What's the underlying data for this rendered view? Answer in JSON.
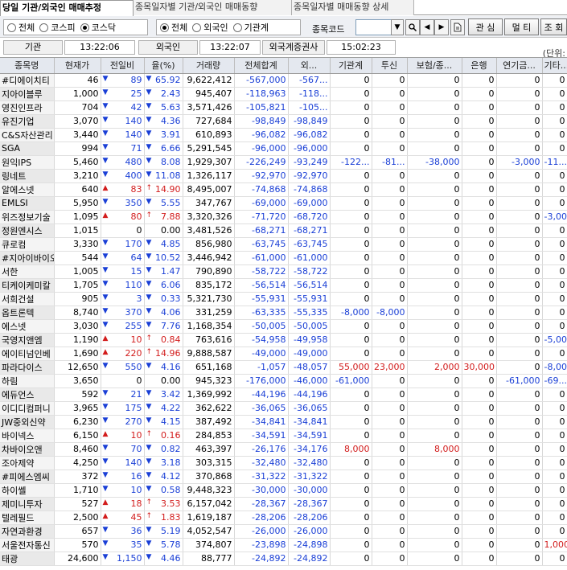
{
  "tabs": [
    {
      "label": "당일 기관/외국인 매매추정",
      "active": true
    },
    {
      "label": "종목일자별 기관/외국인 매매동향",
      "active": false
    },
    {
      "label": "종목일자별 매매동향 상세",
      "active": false
    }
  ],
  "market_filter": {
    "options": [
      "전체",
      "코스피",
      "코스닥"
    ],
    "selected": "코스닥"
  },
  "investor_filter": {
    "options": [
      "전체",
      "외국인",
      "기관계"
    ],
    "selected": "전체"
  },
  "code_label": "종목코드",
  "code_value": "",
  "buttons": {
    "watch": "관 심",
    "multi": "멀 티",
    "query": "조 회"
  },
  "times": {
    "inst_label": "기관",
    "inst_time": "13:22:06",
    "foreign_label": "외국인",
    "foreign_time": "13:22:07",
    "broker_label": "외국계증권사",
    "broker_time": "15:02:23"
  },
  "unit_label": "(단위:",
  "columns": [
    "종목명",
    "현재가",
    "전일비",
    "율(%)",
    "거래량",
    "전체합계",
    "외...",
    "기관계",
    "투신",
    "보험/종...",
    "은행",
    "연기금...",
    "기타..."
  ],
  "rows": [
    {
      "name": "#디에이치티",
      "price": "46",
      "dir": "down",
      "chg": "89",
      "rate": "65.92",
      "vol": "9,622,412",
      "total": "-567,000",
      "fgn": "-567...",
      "inst": "0",
      "trust": "0",
      "ins": "0",
      "bank": "0",
      "pen": "0",
      "etc": "0"
    },
    {
      "name": "지아이블루",
      "price": "1,000",
      "dir": "down",
      "chg": "25",
      "rate": "2.43",
      "vol": "945,407",
      "total": "-118,963",
      "fgn": "-118...",
      "inst": "0",
      "trust": "0",
      "ins": "0",
      "bank": "0",
      "pen": "0",
      "etc": "0"
    },
    {
      "name": "영진인프라",
      "price": "704",
      "dir": "down",
      "chg": "42",
      "rate": "5.63",
      "vol": "3,571,426",
      "total": "-105,821",
      "fgn": "-105...",
      "inst": "0",
      "trust": "0",
      "ins": "0",
      "bank": "0",
      "pen": "0",
      "etc": "0"
    },
    {
      "name": "유진기업",
      "price": "3,070",
      "dir": "down",
      "chg": "140",
      "rate": "4.36",
      "vol": "727,684",
      "total": "-98,849",
      "fgn": "-98,849",
      "inst": "0",
      "trust": "0",
      "ins": "0",
      "bank": "0",
      "pen": "0",
      "etc": "0"
    },
    {
      "name": "C&S자산관리",
      "price": "3,440",
      "dir": "down",
      "chg": "140",
      "rate": "3.91",
      "vol": "610,893",
      "total": "-96,082",
      "fgn": "-96,082",
      "inst": "0",
      "trust": "0",
      "ins": "0",
      "bank": "0",
      "pen": "0",
      "etc": "0"
    },
    {
      "name": "SGA",
      "price": "994",
      "dir": "down",
      "chg": "71",
      "rate": "6.66",
      "vol": "5,291,545",
      "total": "-96,000",
      "fgn": "-96,000",
      "inst": "0",
      "trust": "0",
      "ins": "0",
      "bank": "0",
      "pen": "0",
      "etc": "0"
    },
    {
      "name": "원익IPS",
      "price": "5,460",
      "dir": "down",
      "chg": "480",
      "rate": "8.08",
      "vol": "1,929,307",
      "total": "-226,249",
      "fgn": "-93,249",
      "inst": "-122...",
      "trust": "-81...",
      "ins": "-38,000",
      "bank": "0",
      "pen": "-3,000",
      "etc": "-11..."
    },
    {
      "name": "링네트",
      "price": "3,210",
      "dir": "down",
      "chg": "400",
      "rate": "11.08",
      "vol": "1,326,117",
      "total": "-92,970",
      "fgn": "-92,970",
      "inst": "0",
      "trust": "0",
      "ins": "0",
      "bank": "0",
      "pen": "0",
      "etc": "0"
    },
    {
      "name": "알에스넷",
      "price": "640",
      "dir": "up",
      "chg": "83",
      "rate": "14.90",
      "vol": "8,495,007",
      "total": "-74,868",
      "fgn": "-74,868",
      "inst": "0",
      "trust": "0",
      "ins": "0",
      "bank": "0",
      "pen": "0",
      "etc": "0"
    },
    {
      "name": "EMLSI",
      "price": "5,950",
      "dir": "down",
      "chg": "350",
      "rate": "5.55",
      "vol": "347,767",
      "total": "-69,000",
      "fgn": "-69,000",
      "inst": "0",
      "trust": "0",
      "ins": "0",
      "bank": "0",
      "pen": "0",
      "etc": "0"
    },
    {
      "name": "위즈정보기술",
      "price": "1,095",
      "dir": "up",
      "chg": "80",
      "rate": "7.88",
      "vol": "3,320,326",
      "total": "-71,720",
      "fgn": "-68,720",
      "inst": "0",
      "trust": "0",
      "ins": "0",
      "bank": "0",
      "pen": "0",
      "etc": "-3,000"
    },
    {
      "name": "정원엔시스",
      "price": "1,015",
      "dir": "none",
      "chg": "0",
      "rate": "0.00",
      "vol": "3,481,526",
      "total": "-68,271",
      "fgn": "-68,271",
      "inst": "0",
      "trust": "0",
      "ins": "0",
      "bank": "0",
      "pen": "0",
      "etc": "0"
    },
    {
      "name": "큐로컴",
      "price": "3,330",
      "dir": "down",
      "chg": "170",
      "rate": "4.85",
      "vol": "856,980",
      "total": "-63,745",
      "fgn": "-63,745",
      "inst": "0",
      "trust": "0",
      "ins": "0",
      "bank": "0",
      "pen": "0",
      "etc": "0"
    },
    {
      "name": "#지아이바이오",
      "price": "544",
      "dir": "down",
      "chg": "64",
      "rate": "10.52",
      "vol": "3,446,942",
      "total": "-61,000",
      "fgn": "-61,000",
      "inst": "0",
      "trust": "0",
      "ins": "0",
      "bank": "0",
      "pen": "0",
      "etc": "0"
    },
    {
      "name": "서한",
      "price": "1,005",
      "dir": "down",
      "chg": "15",
      "rate": "1.47",
      "vol": "790,890",
      "total": "-58,722",
      "fgn": "-58,722",
      "inst": "0",
      "trust": "0",
      "ins": "0",
      "bank": "0",
      "pen": "0",
      "etc": "0"
    },
    {
      "name": "티케이케미칼",
      "price": "1,705",
      "dir": "down",
      "chg": "110",
      "rate": "6.06",
      "vol": "835,172",
      "total": "-56,514",
      "fgn": "-56,514",
      "inst": "0",
      "trust": "0",
      "ins": "0",
      "bank": "0",
      "pen": "0",
      "etc": "0"
    },
    {
      "name": "서희건설",
      "price": "905",
      "dir": "down",
      "chg": "3",
      "rate": "0.33",
      "vol": "5,321,730",
      "total": "-55,931",
      "fgn": "-55,931",
      "inst": "0",
      "trust": "0",
      "ins": "0",
      "bank": "0",
      "pen": "0",
      "etc": "0"
    },
    {
      "name": "옵트론텍",
      "price": "8,740",
      "dir": "down",
      "chg": "370",
      "rate": "4.06",
      "vol": "331,259",
      "total": "-63,335",
      "fgn": "-55,335",
      "inst": "-8,000",
      "trust": "-8,000",
      "ins": "0",
      "bank": "0",
      "pen": "0",
      "etc": "0"
    },
    {
      "name": "에스넷",
      "price": "3,030",
      "dir": "down",
      "chg": "255",
      "rate": "7.76",
      "vol": "1,168,354",
      "total": "-50,005",
      "fgn": "-50,005",
      "inst": "0",
      "trust": "0",
      "ins": "0",
      "bank": "0",
      "pen": "0",
      "etc": "0"
    },
    {
      "name": "국영지앤엠",
      "price": "1,190",
      "dir": "up",
      "chg": "10",
      "rate": "0.84",
      "vol": "763,616",
      "total": "-54,958",
      "fgn": "-49,958",
      "inst": "0",
      "trust": "0",
      "ins": "0",
      "bank": "0",
      "pen": "0",
      "etc": "-5,000"
    },
    {
      "name": "에이티넘인베",
      "price": "1,690",
      "dir": "up",
      "chg": "220",
      "rate": "14.96",
      "vol": "9,888,587",
      "total": "-49,000",
      "fgn": "-49,000",
      "inst": "0",
      "trust": "0",
      "ins": "0",
      "bank": "0",
      "pen": "0",
      "etc": "0"
    },
    {
      "name": "파라다이스",
      "price": "12,650",
      "dir": "down",
      "chg": "550",
      "rate": "4.16",
      "vol": "651,168",
      "total": "-1,057",
      "fgn": "-48,057",
      "inst": "55,000",
      "trust": "23,000",
      "ins": "2,000",
      "bank": "30,000",
      "pen": "0",
      "etc": "-8,000"
    },
    {
      "name": "하림",
      "price": "3,650",
      "dir": "none",
      "chg": "0",
      "rate": "0.00",
      "vol": "945,323",
      "total": "-176,000",
      "fgn": "-46,000",
      "inst": "-61,000",
      "trust": "0",
      "ins": "0",
      "bank": "0",
      "pen": "-61,000",
      "etc": "-69..."
    },
    {
      "name": "에듀언스",
      "price": "592",
      "dir": "down",
      "chg": "21",
      "rate": "3.42",
      "vol": "1,369,992",
      "total": "-44,196",
      "fgn": "-44,196",
      "inst": "0",
      "trust": "0",
      "ins": "0",
      "bank": "0",
      "pen": "0",
      "etc": "0"
    },
    {
      "name": "이디디컴퍼니",
      "price": "3,965",
      "dir": "down",
      "chg": "175",
      "rate": "4.22",
      "vol": "362,622",
      "total": "-36,065",
      "fgn": "-36,065",
      "inst": "0",
      "trust": "0",
      "ins": "0",
      "bank": "0",
      "pen": "0",
      "etc": "0"
    },
    {
      "name": "JW중외신약",
      "price": "6,230",
      "dir": "down",
      "chg": "270",
      "rate": "4.15",
      "vol": "387,492",
      "total": "-34,841",
      "fgn": "-34,841",
      "inst": "0",
      "trust": "0",
      "ins": "0",
      "bank": "0",
      "pen": "0",
      "etc": "0"
    },
    {
      "name": "바이넥스",
      "price": "6,150",
      "dir": "up",
      "chg": "10",
      "rate": "0.16",
      "vol": "284,853",
      "total": "-34,591",
      "fgn": "-34,591",
      "inst": "0",
      "trust": "0",
      "ins": "0",
      "bank": "0",
      "pen": "0",
      "etc": "0"
    },
    {
      "name": "차바이오앤",
      "price": "8,460",
      "dir": "down",
      "chg": "70",
      "rate": "0.82",
      "vol": "463,397",
      "total": "-26,176",
      "fgn": "-34,176",
      "inst": "8,000",
      "trust": "0",
      "ins": "8,000",
      "bank": "0",
      "pen": "0",
      "etc": "0"
    },
    {
      "name": "조아제약",
      "price": "4,250",
      "dir": "down",
      "chg": "140",
      "rate": "3.18",
      "vol": "303,315",
      "total": "-32,480",
      "fgn": "-32,480",
      "inst": "0",
      "trust": "0",
      "ins": "0",
      "bank": "0",
      "pen": "0",
      "etc": "0"
    },
    {
      "name": "#피에스엠씨",
      "price": "372",
      "dir": "down",
      "chg": "16",
      "rate": "4.12",
      "vol": "370,868",
      "total": "-31,322",
      "fgn": "-31,322",
      "inst": "0",
      "trust": "0",
      "ins": "0",
      "bank": "0",
      "pen": "0",
      "etc": "0"
    },
    {
      "name": "하이쎌",
      "price": "1,710",
      "dir": "down",
      "chg": "10",
      "rate": "0.58",
      "vol": "9,448,323",
      "total": "-30,000",
      "fgn": "-30,000",
      "inst": "0",
      "trust": "0",
      "ins": "0",
      "bank": "0",
      "pen": "0",
      "etc": "0"
    },
    {
      "name": "제미니투자",
      "price": "527",
      "dir": "up",
      "chg": "18",
      "rate": "3.53",
      "vol": "6,157,042",
      "total": "-28,367",
      "fgn": "-28,367",
      "inst": "0",
      "trust": "0",
      "ins": "0",
      "bank": "0",
      "pen": "0",
      "etc": "0"
    },
    {
      "name": "텔레필드",
      "price": "2,500",
      "dir": "up",
      "chg": "45",
      "rate": "1.83",
      "vol": "1,619,187",
      "total": "-28,206",
      "fgn": "-28,206",
      "inst": "0",
      "trust": "0",
      "ins": "0",
      "bank": "0",
      "pen": "0",
      "etc": "0"
    },
    {
      "name": "자연과환경",
      "price": "657",
      "dir": "down",
      "chg": "36",
      "rate": "5.19",
      "vol": "4,052,547",
      "total": "-26,000",
      "fgn": "-26,000",
      "inst": "0",
      "trust": "0",
      "ins": "0",
      "bank": "0",
      "pen": "0",
      "etc": "0"
    },
    {
      "name": "서울전자통신",
      "price": "570",
      "dir": "down",
      "chg": "35",
      "rate": "5.78",
      "vol": "374,807",
      "total": "-23,898",
      "fgn": "-24,898",
      "inst": "0",
      "trust": "0",
      "ins": "0",
      "bank": "0",
      "pen": "0",
      "etc": "1,000"
    },
    {
      "name": "태광",
      "price": "24,600",
      "dir": "down",
      "chg": "1,150",
      "rate": "4.46",
      "vol": "88,777",
      "total": "-24,892",
      "fgn": "-24,892",
      "inst": "0",
      "trust": "0",
      "ins": "0",
      "bank": "0",
      "pen": "0",
      "etc": "0"
    }
  ],
  "colors": {
    "negative": "#1a3fd6",
    "positive": "#d21c1c",
    "header_bg": "#e4e8ef"
  }
}
